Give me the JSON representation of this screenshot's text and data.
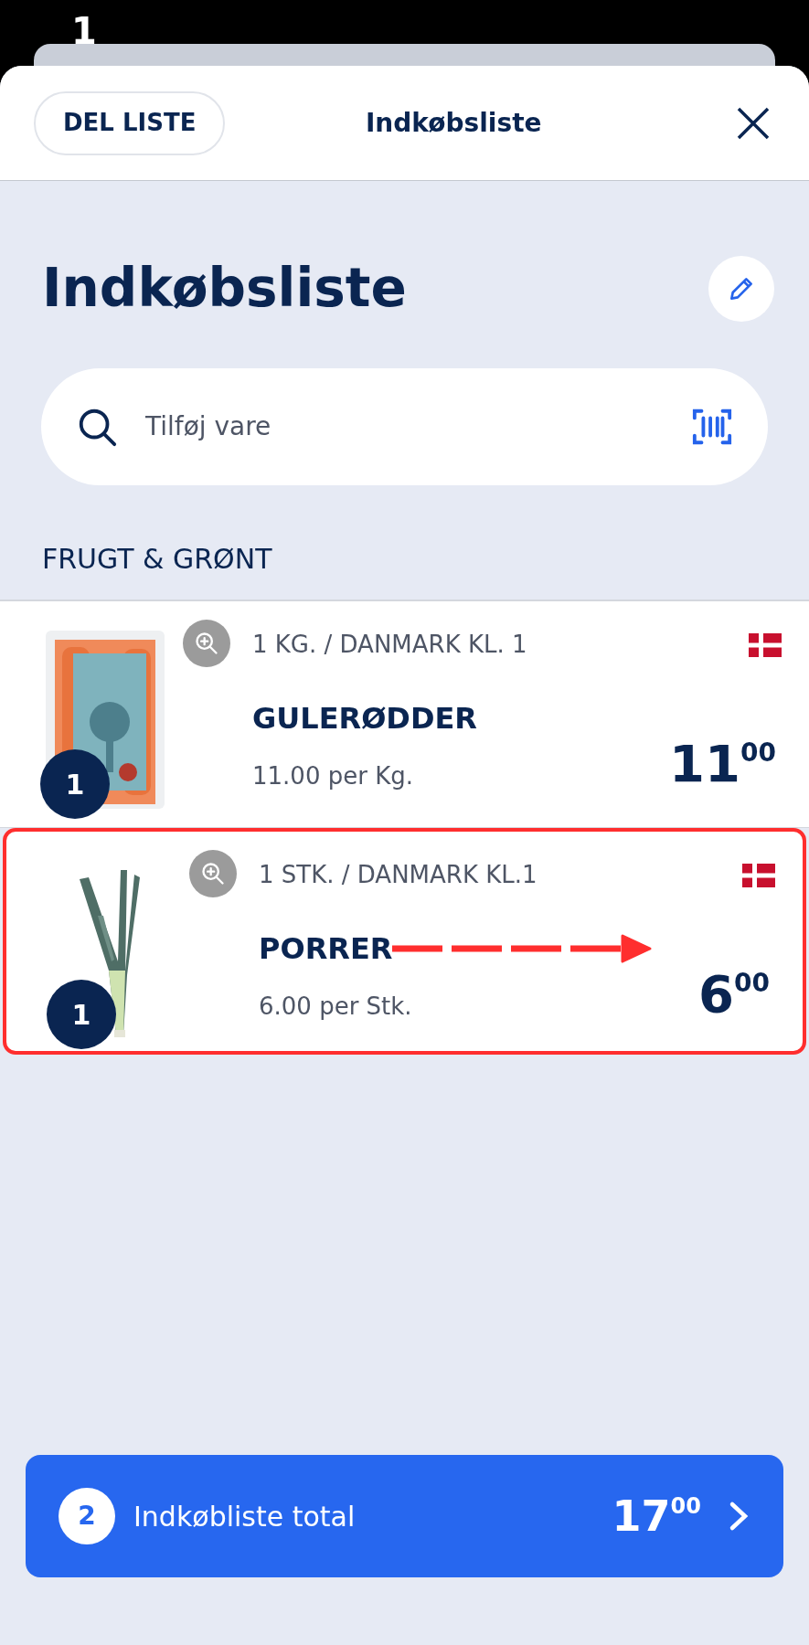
{
  "annotation_label": "1",
  "header": {
    "share_button": "DEL LISTE",
    "title": "Indkøbsliste"
  },
  "page_title": "Indkøbsliste",
  "search": {
    "placeholder": "Tilføj vare"
  },
  "section": {
    "title": "FRUGT & GRØNT"
  },
  "items": [
    {
      "kind": "carrots",
      "size": "1 KG. / DANMARK KL. 1",
      "name": "GULERØDDER",
      "unit_price": "11.00 per Kg.",
      "price_main": "11",
      "price_cents": "00",
      "quantity": "1",
      "highlighted": false,
      "arrow": false
    },
    {
      "kind": "leek",
      "size": "1 STK. / DANMARK KL.1",
      "name": "PORRER",
      "unit_price": "6.00 per Stk.",
      "price_main": "6",
      "price_cents": "00",
      "quantity": "1",
      "highlighted": true,
      "arrow": true
    }
  ],
  "total": {
    "count": "2",
    "label": "Indkøbliste total",
    "price_main": "17",
    "price_cents": "00"
  }
}
